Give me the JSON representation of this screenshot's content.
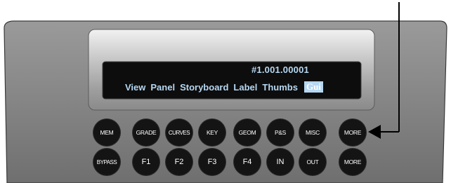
{
  "display": {
    "code": "#1.001.00001",
    "menu_items": [
      {
        "label": "View",
        "selected": false
      },
      {
        "label": "Panel",
        "selected": false
      },
      {
        "label": "Storyboard",
        "selected": false
      },
      {
        "label": "Label",
        "selected": false
      },
      {
        "label": "Thumbs",
        "selected": false
      },
      {
        "label": "Gui",
        "selected": true
      }
    ]
  },
  "buttons": {
    "row1": [
      "MEM",
      "GRADE",
      "CURVES",
      "KEY",
      "GEOM",
      "P&S",
      "MISC",
      "MORE"
    ],
    "row2": [
      "BYPASS",
      "F1",
      "F2",
      "F3",
      "F4",
      "IN",
      "OUT",
      "MORE"
    ]
  },
  "colors": {
    "lcd_text": "#b6d8f2",
    "button_fill": "#141414",
    "console_body": "#7a7a7a"
  }
}
